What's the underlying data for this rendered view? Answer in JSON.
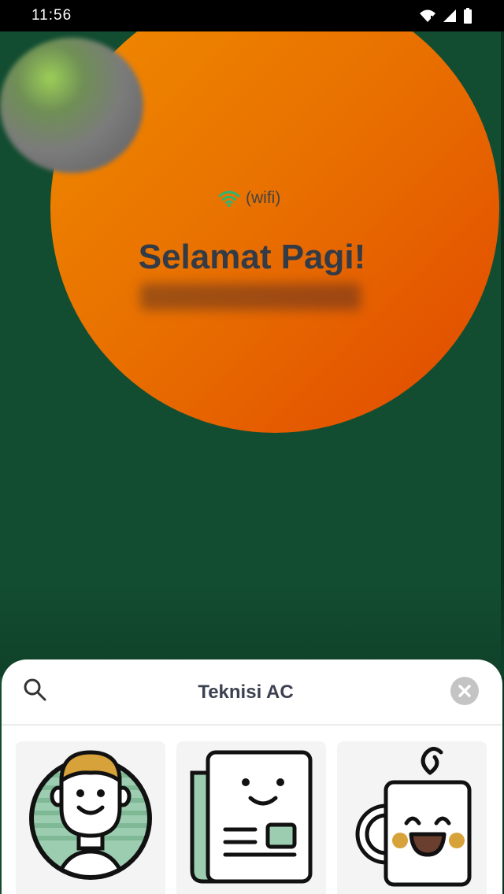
{
  "status_bar": {
    "time": "11:56",
    "icons": [
      "wifi-icon",
      "signal-icon",
      "battery-icon"
    ]
  },
  "hero": {
    "connection_label": "(wifi)",
    "connection_icon": "wifi-icon",
    "greeting": "Selamat Pagi!",
    "colors": {
      "background": "#124d31",
      "circle_start": "#f08c00",
      "circle_end": "#e14800",
      "wifi": "#2bb673"
    }
  },
  "search_sheet": {
    "query": "Teknisi AC",
    "search_icon": "search-icon",
    "clear_icon": "close-icon",
    "tiles": [
      {
        "icon": "person-illustration-icon"
      },
      {
        "icon": "newspaper-illustration-icon"
      },
      {
        "icon": "coffee-mug-illustration-icon"
      }
    ]
  }
}
